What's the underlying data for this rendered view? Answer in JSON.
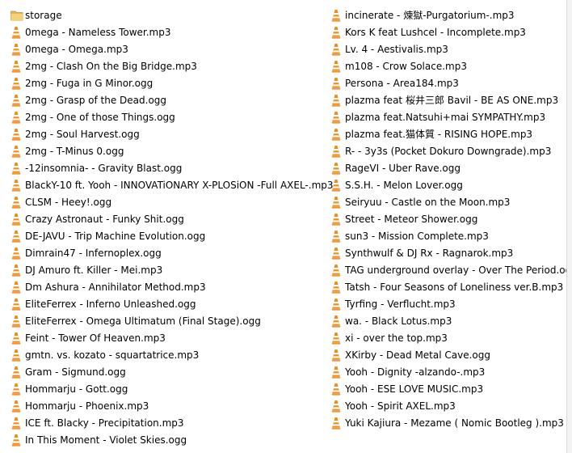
{
  "columns": [
    {
      "items": [
        {
          "type": "folder",
          "name": "storage"
        },
        {
          "type": "vlc",
          "name": "0mega - Nameless Tower.mp3"
        },
        {
          "type": "vlc",
          "name": "0mega - Omega.mp3"
        },
        {
          "type": "vlc",
          "name": "2mg - Clash On the Big Bridge.mp3"
        },
        {
          "type": "vlc",
          "name": "2mg - Fuga in G Minor.ogg"
        },
        {
          "type": "vlc",
          "name": "2mg - Grasp of the Dead.ogg"
        },
        {
          "type": "vlc",
          "name": "2mg - One of those Things.ogg"
        },
        {
          "type": "vlc",
          "name": "2mg - Soul Harvest.ogg"
        },
        {
          "type": "vlc",
          "name": "2mg - T-Minus 0.ogg"
        },
        {
          "type": "vlc",
          "name": "-12insomnia- - Gravity Blast.ogg"
        },
        {
          "type": "vlc",
          "name": "BlackY-10 ft. Yooh - INNOVATiONARY X-PLOSiON -Full AXEL-.mp3"
        },
        {
          "type": "vlc",
          "name": "CLSM - Heey!.ogg"
        },
        {
          "type": "vlc",
          "name": "Crazy Astronaut - Funky Shit.ogg"
        },
        {
          "type": "vlc",
          "name": "DE-JAVU - Trip Machine Evolution.ogg"
        },
        {
          "type": "vlc",
          "name": "Dimrain47 - Infernoplex.ogg"
        },
        {
          "type": "vlc",
          "name": "DJ Amuro ft. Killer - Mei.mp3"
        },
        {
          "type": "vlc",
          "name": "Dm Ashura - Annihilator Method.mp3"
        },
        {
          "type": "vlc",
          "name": "EliteFerrex - Inferno Unleashed.ogg"
        },
        {
          "type": "vlc",
          "name": "EliteFerrex - Omega Ultimatum (Final Stage).ogg"
        },
        {
          "type": "vlc",
          "name": "Feint - Tower Of Heaven.mp3"
        },
        {
          "type": "vlc",
          "name": "gmtn. vs. kozato - squartatrice.mp3"
        },
        {
          "type": "vlc",
          "name": "Gram - Sigmund.ogg"
        },
        {
          "type": "vlc",
          "name": "Hommarju - Gott.ogg"
        },
        {
          "type": "vlc",
          "name": "Hommarju - Phoenix.mp3"
        },
        {
          "type": "vlc",
          "name": "ICE ft. Blacky - Precipitation.mp3"
        },
        {
          "type": "vlc",
          "name": "In This Moment - Violet Skies.ogg"
        }
      ]
    },
    {
      "items": [
        {
          "type": "vlc",
          "name": "incinerate - 煉獄-Purgatorium-.mp3"
        },
        {
          "type": "vlc",
          "name": "Kors K feat Lushcel - Incomplete.mp3"
        },
        {
          "type": "vlc",
          "name": "Lv. 4 - Aestivalis.mp3"
        },
        {
          "type": "vlc",
          "name": "m108 - Crow Solace.mp3"
        },
        {
          "type": "vlc",
          "name": "Persona - Area184.mp3"
        },
        {
          "type": "vlc",
          "name": "plazma feat 桜井三郎 Bavil - BE AS ONE.mp3"
        },
        {
          "type": "vlc",
          "name": "plazma feat.Natsuhi+mai SYMPATHY.mp3"
        },
        {
          "type": "vlc",
          "name": "plazma feat.猫体質 - RISING HOPE.mp3"
        },
        {
          "type": "vlc",
          "name": "R- - 3y3s (Pocket Dokuro Downgrade).mp3"
        },
        {
          "type": "vlc",
          "name": "RageVI - Uber Rave.ogg"
        },
        {
          "type": "vlc",
          "name": "S.S.H. - Melon Lover.ogg"
        },
        {
          "type": "vlc",
          "name": "Seiryuu - Castle on the Moon.mp3"
        },
        {
          "type": "vlc",
          "name": "Street - Meteor Shower.ogg"
        },
        {
          "type": "vlc",
          "name": "sun3 - Mission Complete.mp3"
        },
        {
          "type": "vlc",
          "name": "Synthwulf & DJ Rx - Ragnarok.mp3"
        },
        {
          "type": "vlc",
          "name": "TAG underground overlay - Over The Period.ogg"
        },
        {
          "type": "vlc",
          "name": "Tatsh - Four Seasons of Loneliness ver.B.mp3"
        },
        {
          "type": "vlc",
          "name": "Tyrfing - Verflucht.mp3"
        },
        {
          "type": "vlc",
          "name": "wa. - Black Lotus.mp3"
        },
        {
          "type": "vlc",
          "name": "xi - over the top.mp3"
        },
        {
          "type": "vlc",
          "name": "XKirby - Dead Metal Cave.ogg"
        },
        {
          "type": "vlc",
          "name": "Yooh - Dignity -alzando-.mp3"
        },
        {
          "type": "vlc",
          "name": "Yooh - ESE LOVE MUSIC.mp3"
        },
        {
          "type": "vlc",
          "name": "Yooh - Spirit AXEL.mp3"
        },
        {
          "type": "vlc",
          "name": "Yuki Kajiura - Mezame ( Nomic Bootleg ).mp3"
        }
      ]
    }
  ],
  "icons": {
    "folder": "folder-icon",
    "vlc": "vlc-media-file-icon"
  },
  "colors": {
    "background": "#ffffff",
    "vlc_orange": "#f18a14",
    "vlc_stripe": "#ffffff",
    "folder_yellow": "#f0c75a"
  }
}
